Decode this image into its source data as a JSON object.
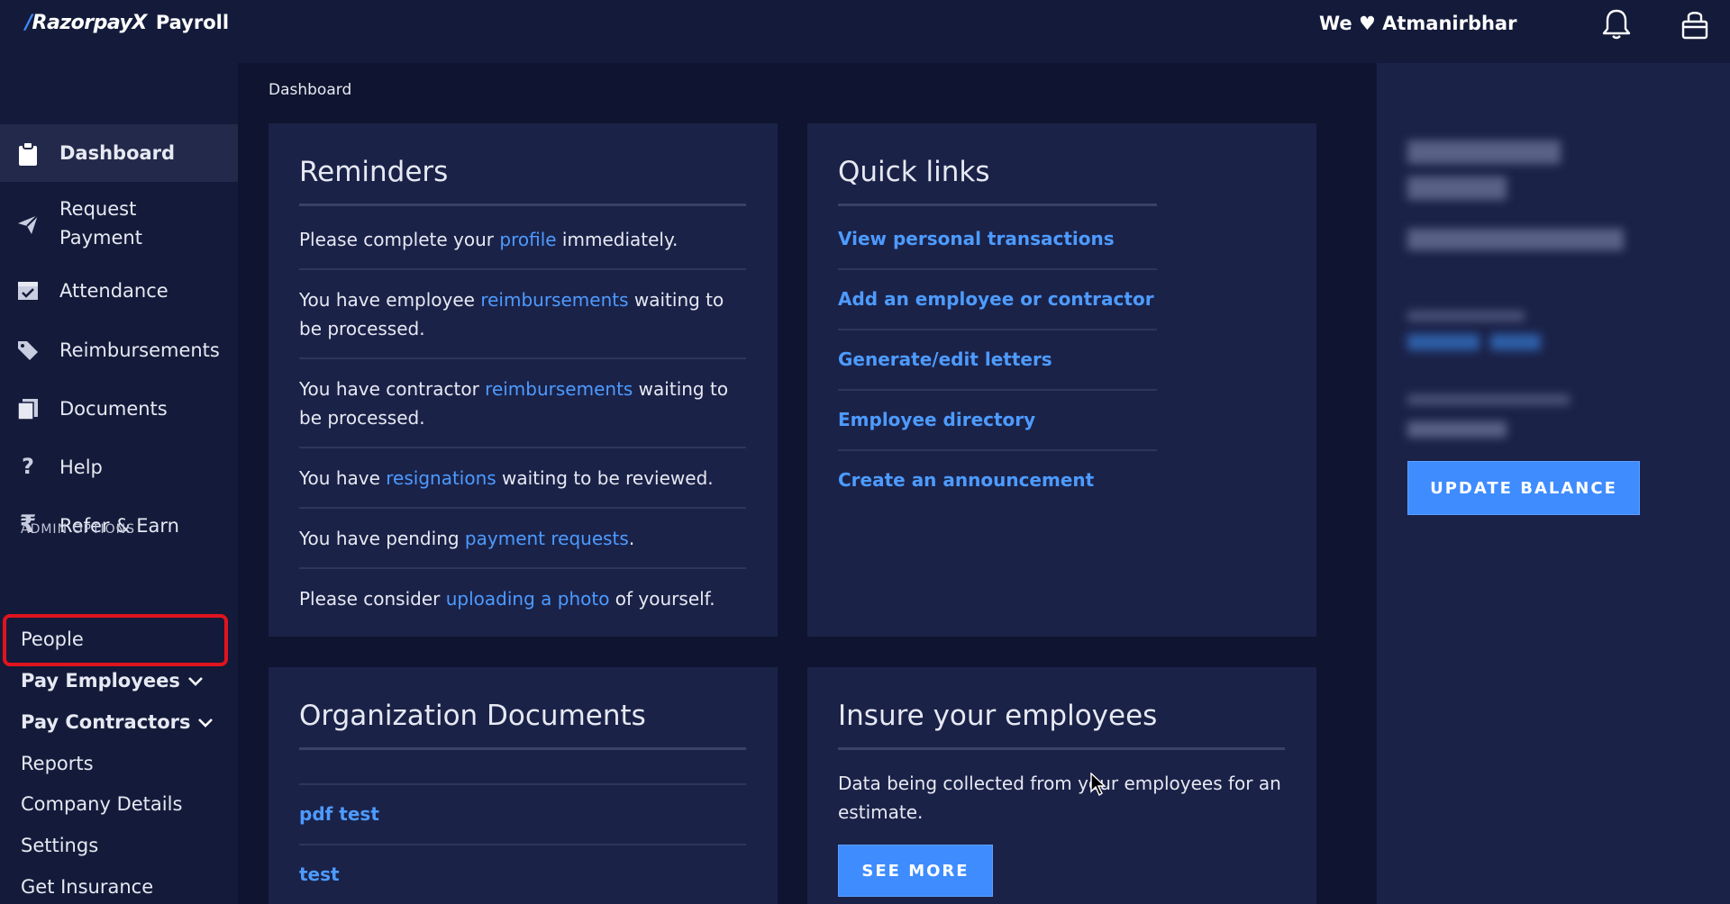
{
  "app": {
    "brand": "RazorpayX",
    "product": "Payroll",
    "tagline": "We ♥ Atmanirbhar",
    "icons": [
      "bell-icon",
      "lock-icon"
    ]
  },
  "sidebar": {
    "items": [
      {
        "label": "Dashboard",
        "icon": "clipboard-icon",
        "active": true
      },
      {
        "label": "Request",
        "label2": "Payment",
        "icon": "paper-plane-icon"
      },
      {
        "label": "Attendance",
        "icon": "calendar-check-icon"
      },
      {
        "label": "Reimbursements",
        "icon": "tag-icon"
      },
      {
        "label": "Documents",
        "icon": "documents-icon"
      },
      {
        "label": "Help",
        "icon": "question-icon"
      },
      {
        "label": "Refer & Earn",
        "icon": "rupee-icon"
      }
    ],
    "admin_heading": "ADMIN OPTIONS",
    "admin_items": [
      {
        "label": "People"
      },
      {
        "label": "Pay Employees",
        "chevron": true
      },
      {
        "label": "Pay Contractors",
        "chevron": true
      },
      {
        "label": "Reports"
      },
      {
        "label": "Company Details"
      },
      {
        "label": "Settings"
      },
      {
        "label": "Get Insurance"
      }
    ]
  },
  "breadcrumb": "Dashboard",
  "reminders": {
    "title": "Reminders",
    "items": [
      {
        "pre": "Please complete your ",
        "link": "profile",
        "post": " immediately."
      },
      {
        "pre": "You have employee ",
        "link": "reimbursements",
        "post": " waiting to be processed."
      },
      {
        "pre": "You have contractor ",
        "link": "reimbursements",
        "post": " waiting to be processed."
      },
      {
        "pre": "You have ",
        "link": "resignations",
        "post": " waiting to be reviewed."
      },
      {
        "pre": "You have pending ",
        "link": "payment requests",
        "post": "."
      },
      {
        "pre": "Please consider ",
        "link": "uploading a photo",
        "post": " of yourself."
      }
    ]
  },
  "quick_links": {
    "title": "Quick links",
    "items": [
      "View personal transactions",
      "Add an employee or contractor",
      "Generate/edit letters",
      "Employee directory",
      "Create an announcement"
    ]
  },
  "org_docs": {
    "title": "Organization Documents",
    "items": [
      "pdf test",
      "test"
    ]
  },
  "insure": {
    "title": "Insure your employees",
    "text": "Data being collected from your employees for an estimate.",
    "button": "SEE MORE"
  },
  "right_panel": {
    "update_button": "UPDATE BALANCE"
  },
  "colors": {
    "background": "#141b3a",
    "card": "#1b2248",
    "link": "#4d9bff",
    "primary_button": "#3f8cff",
    "highlight": "#e0141e"
  }
}
